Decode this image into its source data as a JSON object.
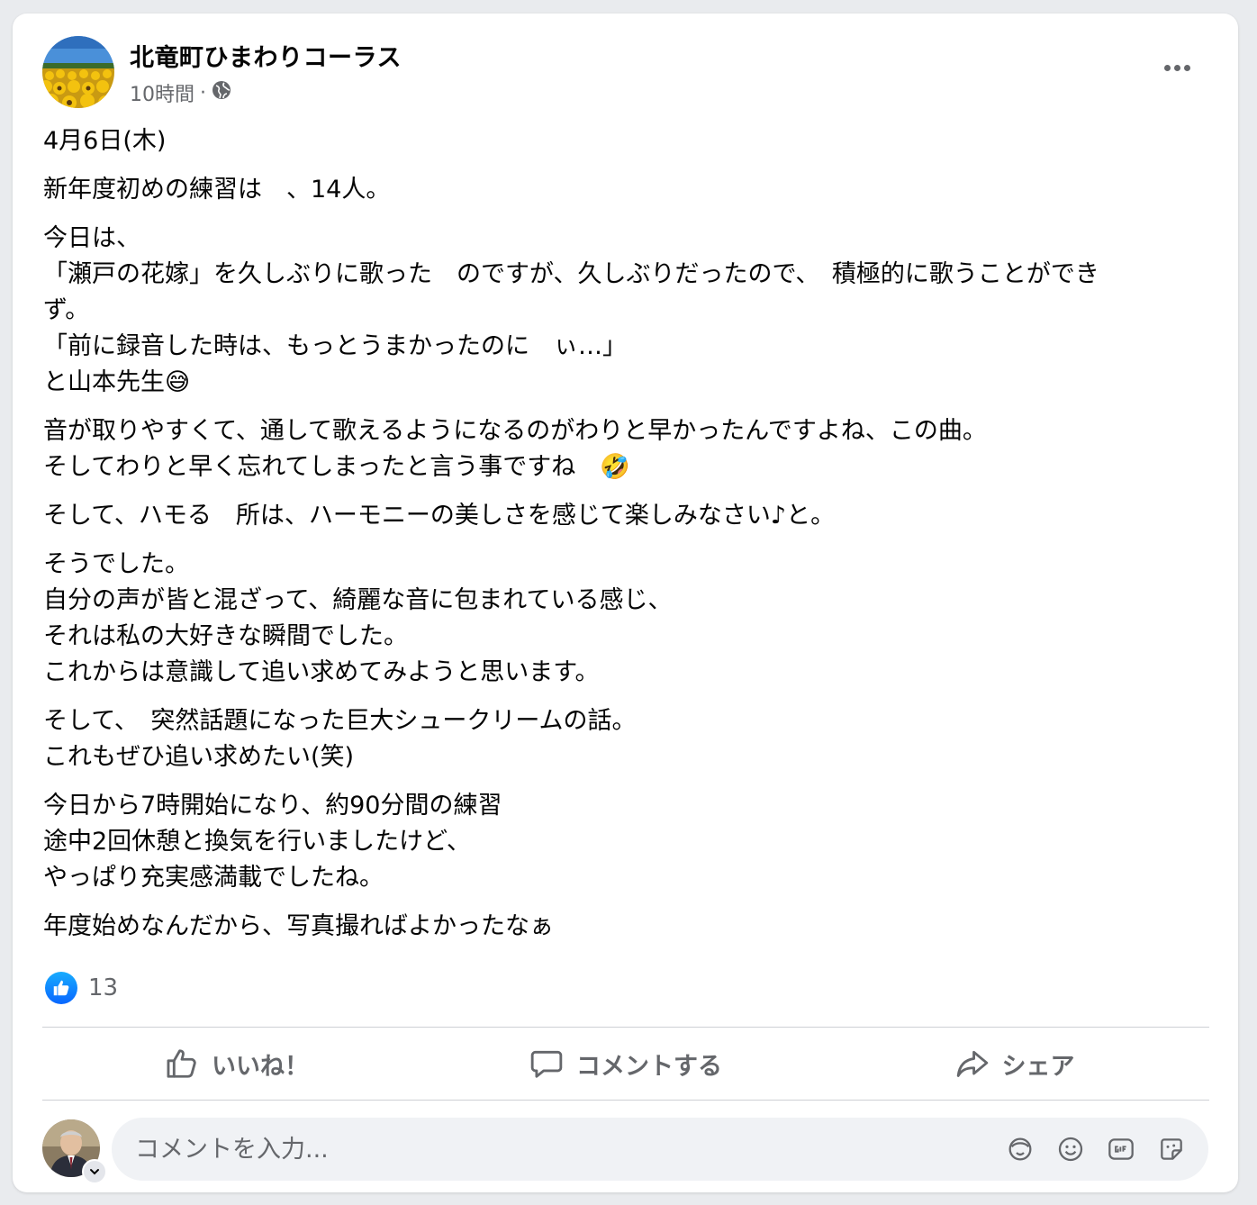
{
  "post": {
    "page_name": "北竜町ひまわりコーラス",
    "time": "10時間",
    "separator": "·",
    "privacy_icon": "globe-icon",
    "more_icon": "more-options-icon",
    "paragraphs": [
      [
        "4月6日(木)"
      ],
      [
        "新年度初めの練習は　、14人。"
      ],
      [
        "今日は、",
        "「瀬戸の花嫁」を久しぶりに歌った　のですが、久しぶりだったので、　積極的に歌うことができ",
        "ず。",
        "「前に録音した時は、もっとうまかったのに　ぃ…」",
        "と山本先生😅"
      ],
      [
        "音が取りやすくて、通して歌えるようになるのがわりと早かったんですよね、この曲。",
        "そしてわりと早く忘れてしまったと言う事ですね　🤣"
      ],
      [
        "そして、ハモる　所は、ハーモニーの美しさを感じて楽しみなさい♪と。"
      ],
      [
        "そうでした。",
        "自分の声が皆と混ざって、綺麗な音に包まれている感じ、",
        "それは私の大好きな瞬間でした。",
        "これからは意識して追い求めてみようと思います。"
      ],
      [
        "そして、　突然話題になった巨大シュークリームの話。",
        "これもぜひ追い求めたい(笑)"
      ],
      [
        "今日から7時開始になり、約90分間の練習",
        "途中2回休憩と換気を行いましたけど、",
        "やっぱり充実感満載でしたね。"
      ],
      [
        "年度始めなんだから、写真撮ればよかったなぁ"
      ]
    ]
  },
  "reactions": {
    "icon": "like-reaction-icon",
    "count": "13"
  },
  "actions": {
    "like_label": "いいね！",
    "comment_label": "コメントする",
    "share_label": "シェア"
  },
  "comment": {
    "placeholder": "コメントを入力...",
    "tools": [
      "avatar-sticker-icon",
      "emoji-icon",
      "gif-icon",
      "sticker-icon"
    ]
  },
  "colors": {
    "accent": "#0866ff",
    "secondary_text": "#65676b",
    "divider": "#ced0d4",
    "input_bg": "#f0f2f5"
  }
}
